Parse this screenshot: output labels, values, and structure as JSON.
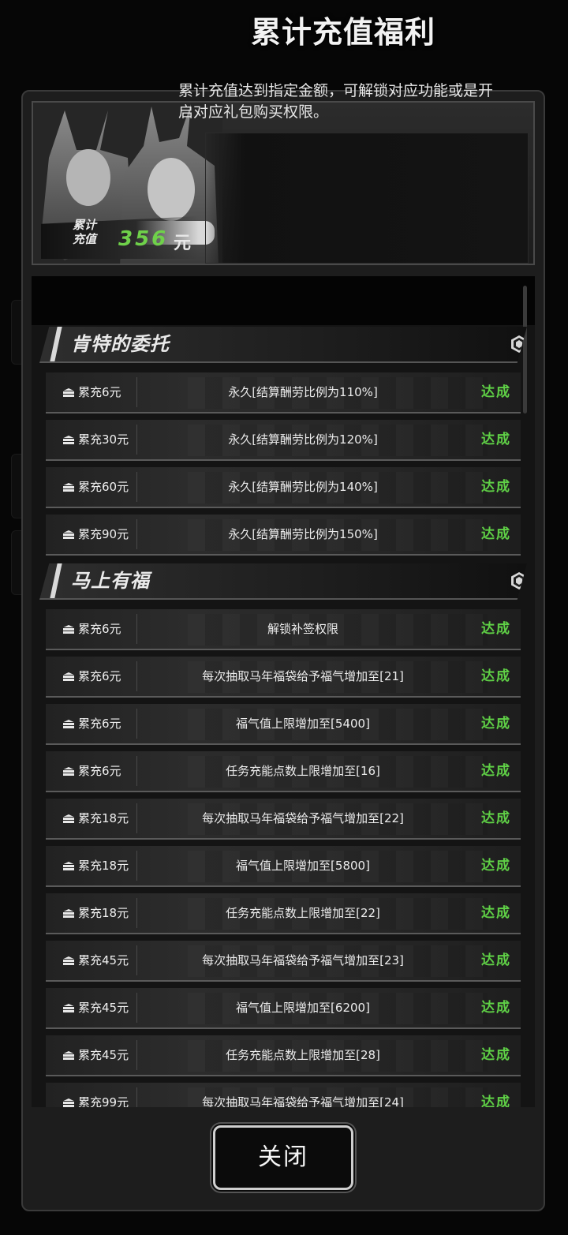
{
  "header": {
    "title": "累计充值福利",
    "description": "累计充值达到指定金额，可解锁对应功能或是开启对应礼包购买权限。",
    "amount_label_line1": "累计",
    "amount_label_line2": "充值",
    "amount_value": "356",
    "amount_unit": "元"
  },
  "sections": [
    {
      "title": "肯特的委托",
      "rows": [
        {
          "req": "累充6元",
          "desc": "永久[结算酬劳比例为110%]",
          "status": "达成"
        },
        {
          "req": "累充30元",
          "desc": "永久[结算酬劳比例为120%]",
          "status": "达成"
        },
        {
          "req": "累充60元",
          "desc": "永久[结算酬劳比例为140%]",
          "status": "达成"
        },
        {
          "req": "累充90元",
          "desc": "永久[结算酬劳比例为150%]",
          "status": "达成"
        }
      ]
    },
    {
      "title": "马上有福",
      "rows": [
        {
          "req": "累充6元",
          "desc": "解锁补签权限",
          "status": "达成"
        },
        {
          "req": "累充6元",
          "desc": "每次抽取马年福袋给予福气增加至[21]",
          "status": "达成"
        },
        {
          "req": "累充6元",
          "desc": "福气值上限增加至[5400]",
          "status": "达成"
        },
        {
          "req": "累充6元",
          "desc": "任务充能点数上限增加至[16]",
          "status": "达成"
        },
        {
          "req": "累充18元",
          "desc": "每次抽取马年福袋给予福气增加至[22]",
          "status": "达成"
        },
        {
          "req": "累充18元",
          "desc": "福气值上限增加至[5800]",
          "status": "达成"
        },
        {
          "req": "累充18元",
          "desc": "任务充能点数上限增加至[22]",
          "status": "达成"
        },
        {
          "req": "累充45元",
          "desc": "每次抽取马年福袋给予福气增加至[23]",
          "status": "达成"
        },
        {
          "req": "累充45元",
          "desc": "福气值上限增加至[6200]",
          "status": "达成"
        },
        {
          "req": "累充45元",
          "desc": "任务充能点数上限增加至[28]",
          "status": "达成"
        },
        {
          "req": "累充99元",
          "desc": "每次抽取马年福袋给予福气增加至[24]",
          "status": "达成"
        }
      ]
    }
  ],
  "close_label": "关闭",
  "colors": {
    "status": "#5fd046",
    "amount": "#6fd14a"
  }
}
